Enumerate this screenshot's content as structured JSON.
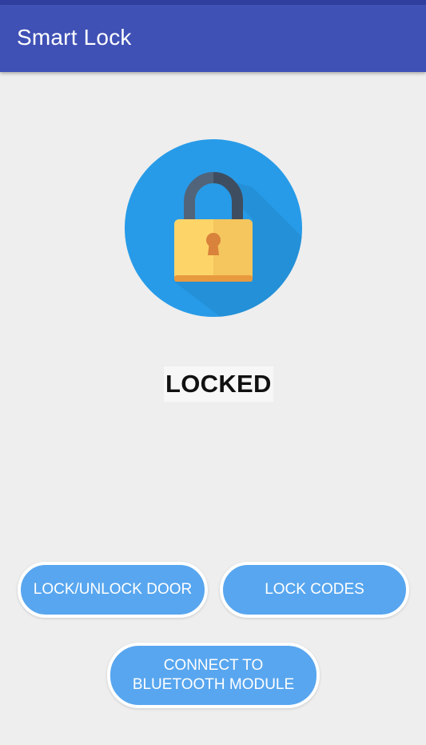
{
  "app_bar": {
    "title": "Smart Lock"
  },
  "lock_status": {
    "icon": "padlock-icon",
    "label": "LOCKED"
  },
  "buttons": {
    "lock_unlock": "LOCK/UNLOCK DOOR",
    "lock_codes": "LOCK CODES",
    "bluetooth": "CONNECT TO\nBLUETOOTH MODULE"
  },
  "colors": {
    "app_bar": "#3f51b5",
    "status_bar": "#303f9f",
    "background": "#eeeeee",
    "button": "#58a6ef",
    "lock_circle": "#279be8",
    "lock_body": "#fdd468",
    "lock_shackle": "#4a5b6e",
    "keyhole": "#d9823b"
  }
}
